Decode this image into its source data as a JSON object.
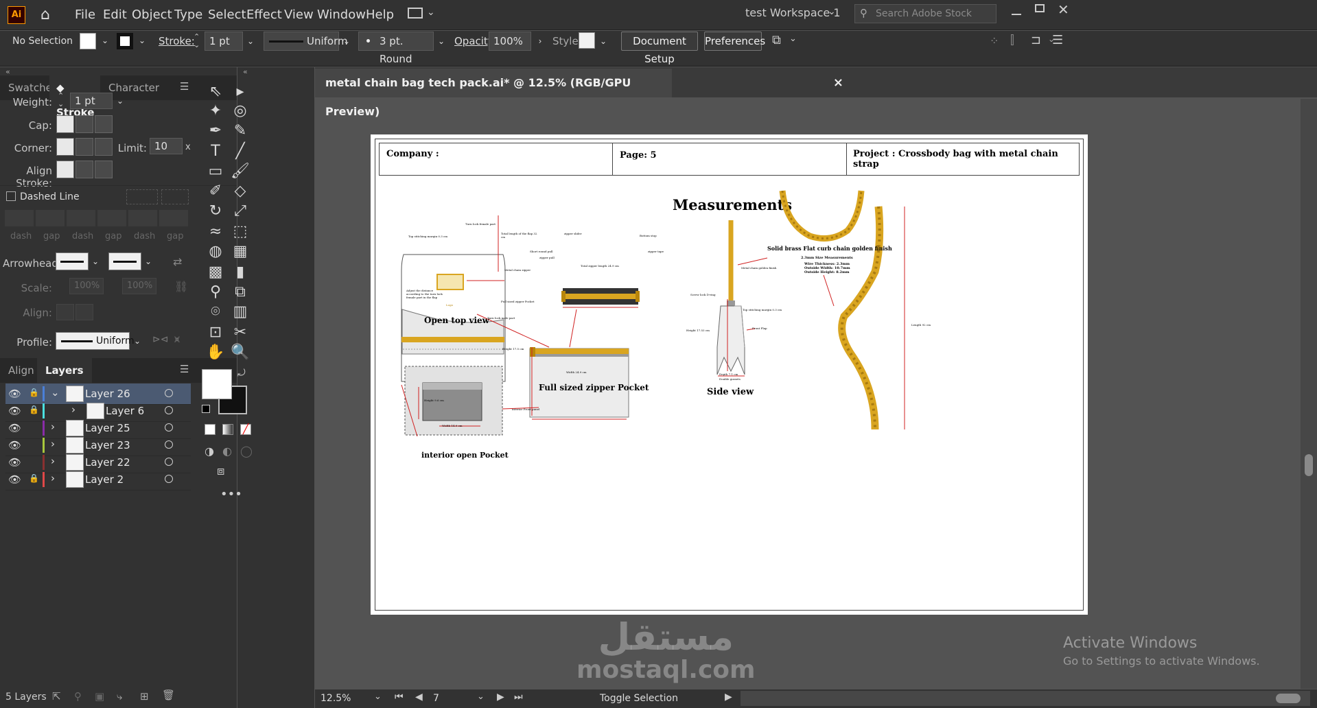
{
  "app": {
    "logo": "Ai"
  },
  "menu": [
    "File",
    "Edit",
    "Object",
    "Type",
    "Select",
    "Effect",
    "View",
    "Window",
    "Help"
  ],
  "workspace": "test Workspace 1",
  "search_placeholder": "Search Adobe Stock",
  "control": {
    "selection": "No Selection",
    "stroke_label": "Stroke:",
    "stroke_weight": "1 pt",
    "profile": "Uniform",
    "brush": "3 pt. Round",
    "opacity_label": "Opacity:",
    "opacity": "100%",
    "style_label": "Style:",
    "doc_setup": "Document Setup",
    "preferences": "Preferences"
  },
  "stroke_panel": {
    "tabs": [
      "Swatches",
      "Stroke",
      "Character"
    ],
    "weight_label": "Weight:",
    "weight": "1 pt",
    "cap_label": "Cap:",
    "corner_label": "Corner:",
    "limit_label": "Limit:",
    "limit": "10",
    "limit_unit": "x",
    "align_label": "Align Stroke:",
    "dashed": "Dashed Line",
    "dash_labels": [
      "dash",
      "gap",
      "dash",
      "gap",
      "dash",
      "gap"
    ],
    "arrow_label": "Arrowheads:",
    "scale_label": "Scale:",
    "scale1": "100%",
    "scale2": "100%",
    "align2_label": "Align:",
    "profile_label": "Profile:",
    "profile": "Uniform"
  },
  "layers_panel": {
    "tabs": [
      "Align",
      "Layers"
    ],
    "layers": [
      {
        "name": "Layer 26",
        "color": "#4a7fd8",
        "locked": true
      },
      {
        "name": "Layer 6",
        "color": "#4ae0e0",
        "locked": true
      },
      {
        "name": "Layer 25",
        "color": "#8a2ca8",
        "locked": false
      },
      {
        "name": "Layer 23",
        "color": "#a8c83c",
        "locked": false
      },
      {
        "name": "Layer 22",
        "color": "#8a3030",
        "locked": false
      },
      {
        "name": "Layer 2",
        "color": "#e04848",
        "locked": true
      }
    ],
    "count": "5 Layers"
  },
  "document": {
    "tab_title": "metal chain  bag tech pack.ai* @ 12.5% (RGB/GPU Preview)",
    "close": "×"
  },
  "artboard": {
    "company": "Company :",
    "page": "Page: 5",
    "project": "Project : Crossbody bag with metal chain strap",
    "heading": "Measurements",
    "open_top": "Open top view",
    "zipper_pocket": "Full sized zipper Pocket",
    "interior_pocket": "interior open Pocket",
    "side_view": "Side view",
    "chain_title": "Solid brass Flat curb chain golden finish",
    "chain_specs": [
      "2.3mm Size Measurements",
      "Wire Thickness: 2.3mm",
      "Outside Width: 10.7mm",
      "Outside Height: 8.2mm"
    ],
    "notes": {
      "turn_lock_female": "Turn lock female part",
      "top_stitch": "Top stitching margin 0.3 cm",
      "flap_len": "Total length of the flap 32 cm",
      "metal_zipper": "Metal chain zipper",
      "full_zip": "Full sized zipper Pocket",
      "turn_lock_male": "Turn lock male part",
      "logo": "Logo",
      "zipper_slider": "zipper slider",
      "bottom_stop": "Bottom stop",
      "short_pull": "Short round pull",
      "zipper_pull": "zipper pull",
      "zipper_tape": "zipper tape",
      "zip_length": "Total zipper length 24.9 cm",
      "height_175": "Height 17.5 cm",
      "width_249": "Width 24.9 cm",
      "height_96": "Height 9.6 cm",
      "width_149": "Width 14.9 cm",
      "interior_panel": "interior Front panel",
      "metal_chain": "Metal chain golden finish",
      "screw_lock": "Screw lock D-ring",
      "top_stitch_side": "Top stitching margin 0.3 cm",
      "front_flap": "Front Flap",
      "height_1753": "Height 17.53 cm",
      "depth": "Depth 7.1 cm",
      "double_gussets": "Double gussets",
      "length_92": "Length 92 cm",
      "adjust": "Adjust the distance according to the turn lock female part in the flap"
    }
  },
  "status": {
    "zoom": "12.5%",
    "page": "7",
    "mode": "Toggle Selection"
  },
  "watermark": {
    "text1": "مستقل",
    "text2": "mostaql.com"
  },
  "activate": {
    "line1": "Activate Windows",
    "line2": "Go to Settings to activate Windows."
  }
}
